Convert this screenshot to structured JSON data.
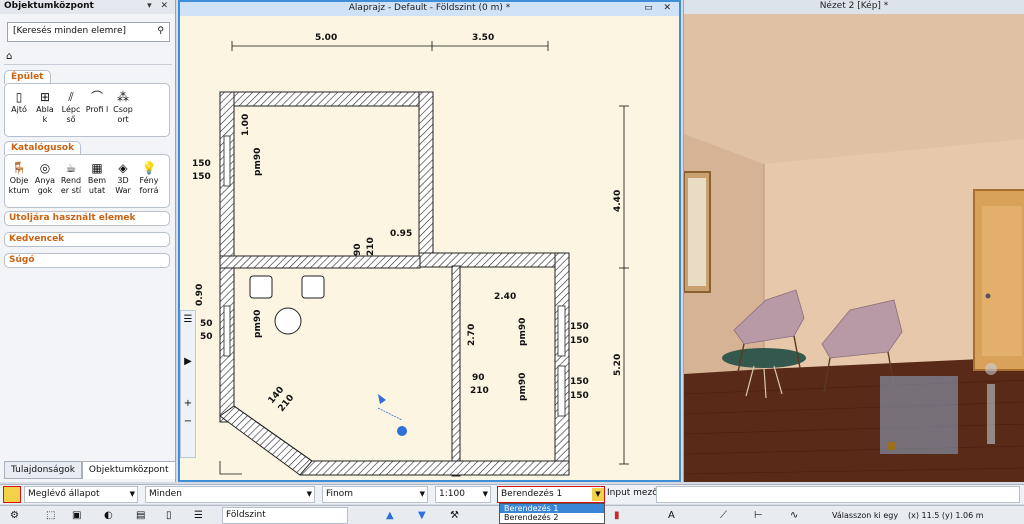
{
  "left_panel": {
    "title": "Objektumközpont",
    "controls": "▾ ✕",
    "search_placeholder": "[Keresés minden elemre]",
    "groups": [
      {
        "title": "Épület",
        "items": [
          {
            "label": "Ajtó",
            "icon": "door-icon",
            "glyph": "▯"
          },
          {
            "label": "Abla k",
            "icon": "window-icon",
            "glyph": "⊞"
          },
          {
            "label": "Lépc ső",
            "icon": "stairs-icon",
            "glyph": "⫽"
          },
          {
            "label": "Profi l",
            "icon": "profile-icon",
            "glyph": "⌒"
          },
          {
            "label": "Csop ort",
            "icon": "group-icon",
            "glyph": "⁂"
          }
        ]
      },
      {
        "title": "Katalógusok",
        "items": [
          {
            "label": "Obje ktum",
            "icon": "object-icon",
            "glyph": "🪑"
          },
          {
            "label": "Anya gok",
            "icon": "material-icon",
            "glyph": "◎"
          },
          {
            "label": "Rend er stí",
            "icon": "render-icon",
            "glyph": "☕"
          },
          {
            "label": "Bem utat",
            "icon": "showcase-icon",
            "glyph": "▦"
          },
          {
            "label": "3D War",
            "icon": "warehouse-icon",
            "glyph": "◈"
          },
          {
            "label": "Fény forrá",
            "icon": "light-icon",
            "glyph": "💡"
          }
        ]
      }
    ],
    "collapsed": [
      "Utoljára használt elemek",
      "Kedvencek",
      "Súgó"
    ],
    "tabs": [
      "Tulajdonságok",
      "Objektumközpont"
    ]
  },
  "plan": {
    "title": "Alaprajz - Default - Földszint (0 m) *",
    "window_controls": "▭ ✕",
    "dims": [
      "5.00",
      "3.50",
      "1.00",
      "150",
      "150",
      "0.95",
      "4.40",
      "0.90",
      "2.40",
      "2.70",
      "150",
      "150",
      "150",
      "150",
      "5.20",
      "150",
      "150",
      "90",
      "210",
      "90",
      "210",
      "140",
      "210",
      "pm90",
      "pm90",
      "pm90",
      "pm90",
      "50",
      "50"
    ],
    "left_tools": [
      "☰",
      "▶",
      "+",
      "−"
    ]
  },
  "view3d": {
    "title": "Nézet 2 [Kép] *"
  },
  "statusbar": {
    "state": "Meglévő állapot",
    "filter": "Minden",
    "quality": "Finom",
    "scale": "1:100",
    "furnishing": "Berendezés 1",
    "input_label": "Input mező",
    "dropdown_options": [
      "Berendezés 1",
      "Berendezés 2"
    ]
  },
  "toolbar2": {
    "floor": "Földszint",
    "hint": "Válasszon ki egy",
    "coords": "(x) 11.5  (y) 1.06 m"
  },
  "colors": {
    "accent": "#3f8fd8",
    "section_orange": "#c86414",
    "plan_bg": "#fbf5e2",
    "wall_bg": "#e1c1a4",
    "floor_wood": "#5a2a18"
  }
}
